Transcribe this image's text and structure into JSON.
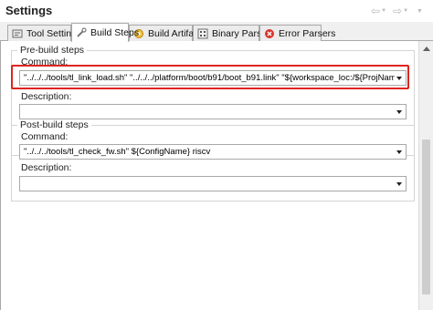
{
  "window": {
    "title": "Settings"
  },
  "nav": {
    "back_icon": "arrow-left-icon",
    "forward_icon": "arrow-right-icon"
  },
  "tabs": [
    {
      "label": "Tool Settings",
      "icon": "tool-settings-icon",
      "active": false
    },
    {
      "label": "Build Steps",
      "icon": "wrench-icon",
      "active": true
    },
    {
      "label": "Build Artifact",
      "icon": "artifact-gear-icon",
      "active": false
    },
    {
      "label": "Binary Parsers",
      "icon": "binary-parsers-icon",
      "active": false
    },
    {
      "label": "Error Parsers",
      "icon": "error-parsers-icon",
      "active": false
    }
  ],
  "pre_build": {
    "group_label": "Pre-build steps",
    "command_label": "Command:",
    "command_value": "\"../../../tools/tl_link_load.sh\" \"../../../platform/boot/b91/boot_b91.link\" \"${workspace_loc:/${ProjName}}/boot.link\"",
    "description_label": "Description:",
    "description_value": ""
  },
  "post_build": {
    "group_label": "Post-build steps",
    "command_label": "Command:",
    "command_value": "\"../../../tools/tl_check_fw.sh\" ${ConfigName} riscv",
    "description_label": "Description:",
    "description_value": ""
  },
  "colors": {
    "highlight": "#e0241f",
    "tab_border": "#a9a9a9",
    "group_border": "#d5d5d5"
  }
}
